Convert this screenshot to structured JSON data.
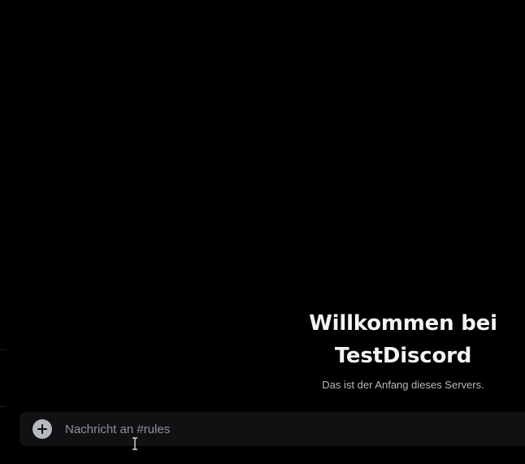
{
  "welcome": {
    "title_line1": "Willkommen bei",
    "title_line2": "TestDiscord",
    "subtitle": "Das ist der Anfang dieses Servers."
  },
  "composer": {
    "placeholder": "Nachricht an #rules",
    "add_icon": "plus-circle-icon"
  },
  "colors": {
    "background": "#000000",
    "composer_bg": "#111113",
    "title": "#f2f3f5",
    "subtitle": "#b5bac1",
    "placeholder": "#8e9297"
  }
}
